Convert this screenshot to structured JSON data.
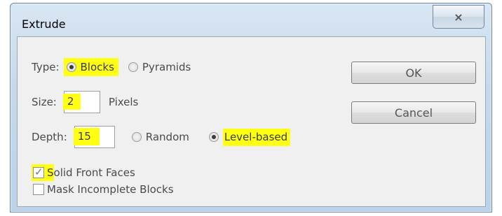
{
  "dialog": {
    "title": "Extrude",
    "close_glyph": "⨯"
  },
  "type": {
    "label": "Type:",
    "options": [
      {
        "label": "Blocks",
        "checked": true
      },
      {
        "label": "Pyramids",
        "checked": false
      }
    ]
  },
  "size": {
    "label": "Size:",
    "value": "2",
    "unit": "Pixels"
  },
  "depth": {
    "label": "Depth:",
    "value": "15",
    "options": [
      {
        "label": "Random",
        "checked": false
      },
      {
        "label": "Level-based",
        "checked": true
      }
    ]
  },
  "checkboxes": [
    {
      "label_first": "S",
      "label_rest": "olid Front Faces",
      "checked": true
    },
    {
      "label": "Mask Incomplete Blocks",
      "checked": false
    }
  ],
  "buttons": {
    "ok": "OK",
    "cancel": "Cancel"
  },
  "colors": {
    "highlight": "#ffff14"
  }
}
